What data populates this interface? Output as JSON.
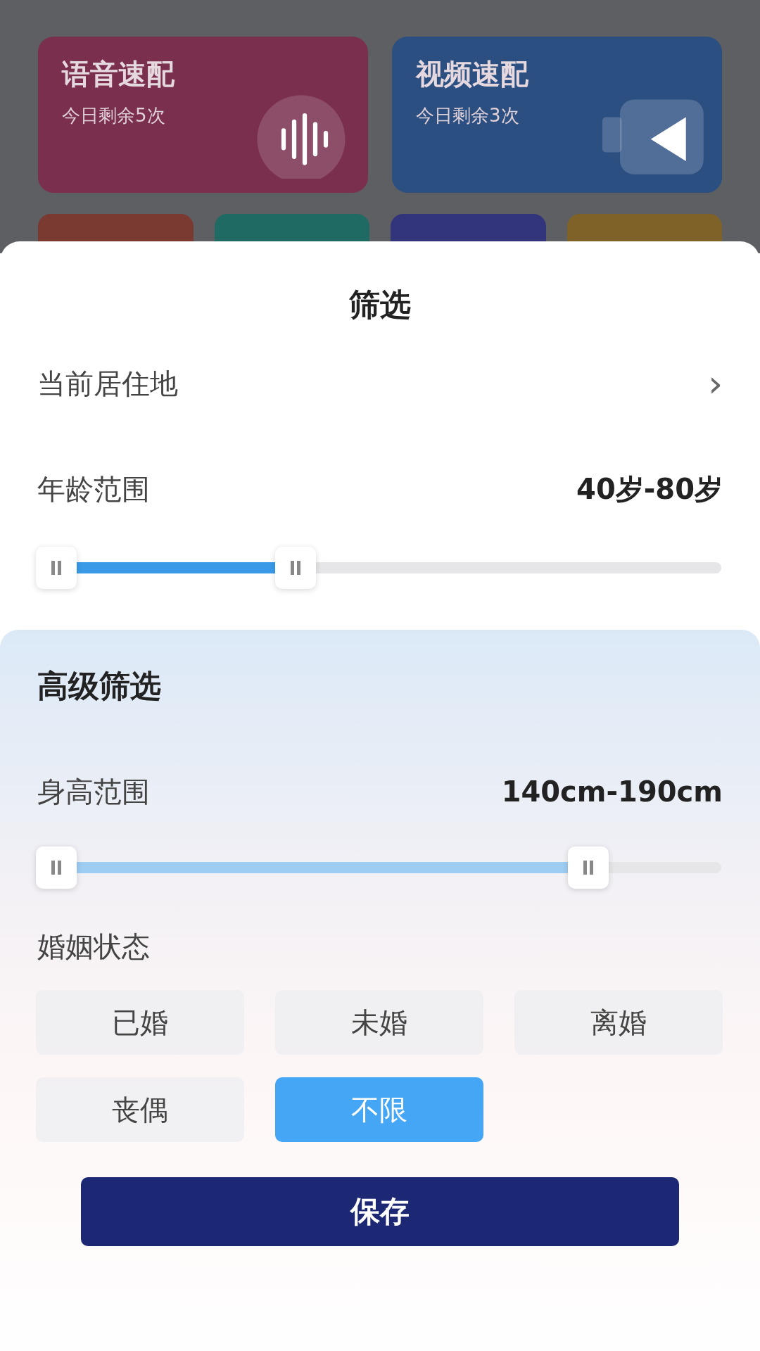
{
  "background": {
    "cards": [
      {
        "title": "语音速配",
        "subtitle": "今日剩余5次",
        "kind": "voice",
        "color": "#7a2f4f"
      },
      {
        "title": "视频速配",
        "subtitle": "今日剩余3次",
        "kind": "video",
        "color": "#2a4f80"
      }
    ],
    "tiles": [
      {
        "color": "#7a3a32"
      },
      {
        "color": "#1f6a63"
      },
      {
        "color": "#33357c"
      },
      {
        "color": "#7f6228"
      }
    ]
  },
  "sheet": {
    "title": "筛选",
    "location": {
      "label": "当前居住地",
      "chevron": "›"
    },
    "age": {
      "label": "年龄范围",
      "value": "40岁-80岁",
      "thumbs": [
        {
          "level": 0
        },
        {
          "level": 0.36
        }
      ]
    },
    "advanced": {
      "title": "高级筛选",
      "height": {
        "label": "身高范围",
        "value": "140cm-190cm",
        "thumbs": [
          {
            "level": 0
          },
          {
            "level": 0.8
          }
        ]
      },
      "marital": {
        "label": "婚姻状态",
        "options": [
          {
            "label": "已婚",
            "selected": false
          },
          {
            "label": "未婚",
            "selected": false
          },
          {
            "label": "离婚",
            "selected": false
          },
          {
            "label": "丧偶",
            "selected": false
          },
          {
            "label": "不限",
            "selected": true
          }
        ]
      }
    },
    "save": "保存"
  }
}
